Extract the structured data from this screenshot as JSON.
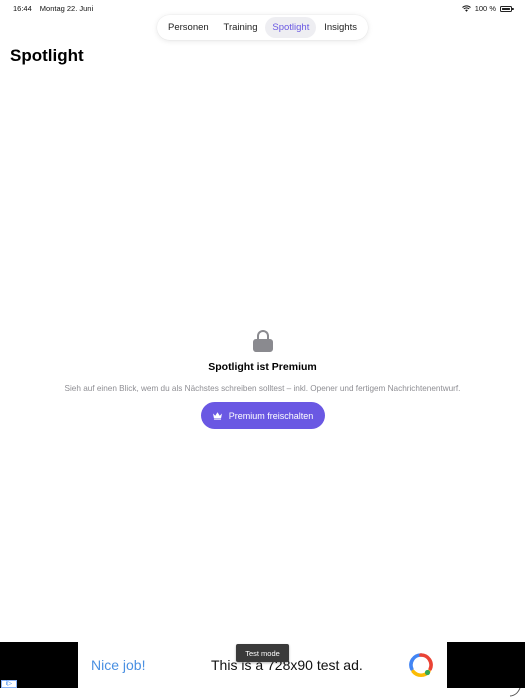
{
  "status": {
    "time": "16:44",
    "date": "Montag 22. Juni",
    "battery": "100 %"
  },
  "tabs": [
    {
      "label": "Personen",
      "active": false
    },
    {
      "label": "Training",
      "active": false
    },
    {
      "label": "Spotlight",
      "active": true
    },
    {
      "label": "Insights",
      "active": false
    }
  ],
  "page": {
    "title": "Spotlight"
  },
  "empty_state": {
    "title": "Spotlight ist Premium",
    "description": "Sieh auf einen Blick, wem du als Nächstes schreiben solltest – inkl. Opener und fertigem Nachrichtenentwurf.",
    "cta_label": "Premium freischalten"
  },
  "ad": {
    "tagline": "Nice job!",
    "text": "This is a 728x90 test ad.",
    "test_mode": "Test mode"
  },
  "icons": {
    "lock": "lock-icon",
    "crown": "crown-icon",
    "wifi": "wifi-icon",
    "battery": "battery-icon"
  },
  "colors": {
    "accent": "#6a58e3",
    "accent_tint": "#eeeef2",
    "ad_link": "#4a90e2",
    "muted": "#8e8e93"
  }
}
